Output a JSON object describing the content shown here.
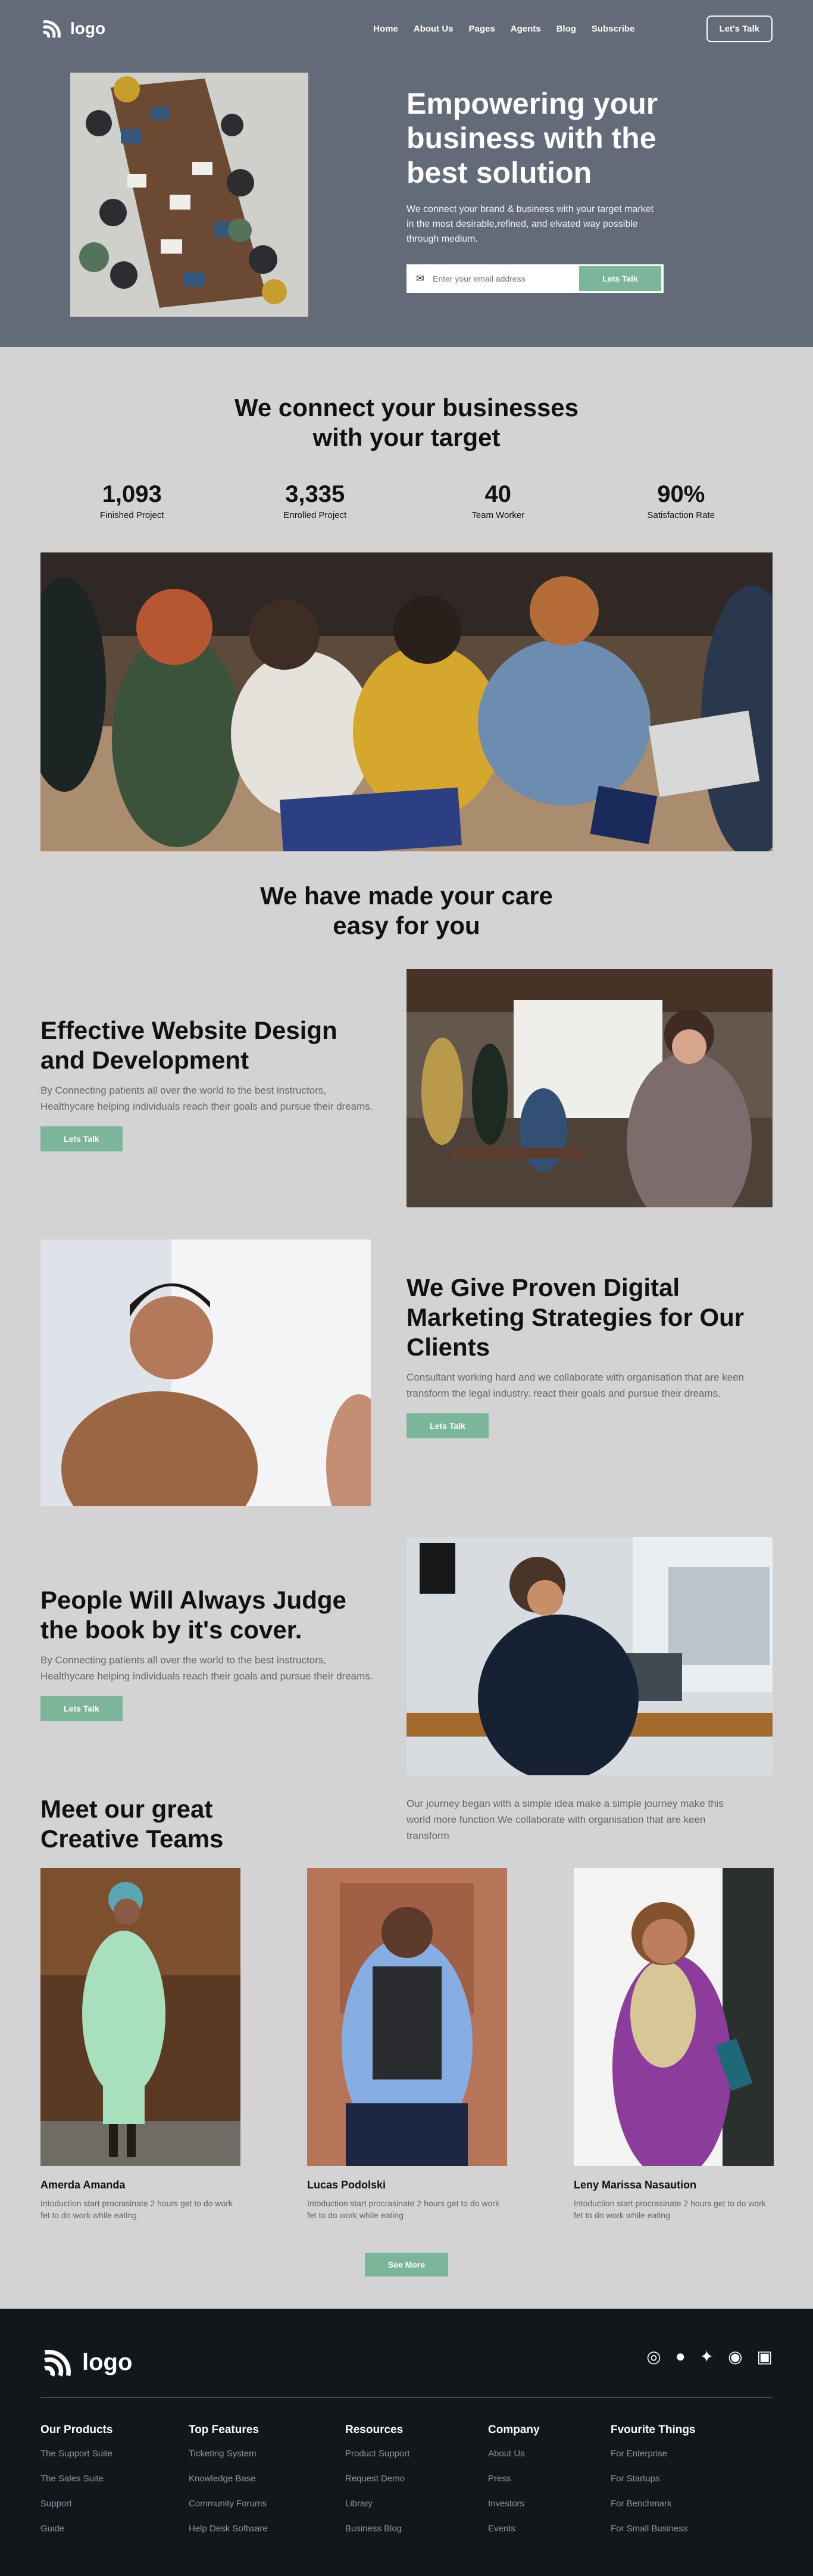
{
  "header": {
    "logo_text": "logo",
    "nav": [
      {
        "label": "Home"
      },
      {
        "label": "About Us"
      },
      {
        "label": "Pages"
      },
      {
        "label": "Agents"
      },
      {
        "label": "Blog"
      },
      {
        "label": "Subscribe"
      }
    ],
    "cta": "Let's Talk"
  },
  "hero": {
    "title": "Empowering your business with the best solution",
    "body": "We connect your brand & business with your target market in the most desirable,refined, and elvated way possible through medium.",
    "email_placeholder": "Enter your email address",
    "button": "Lets Talk"
  },
  "connect": {
    "title": "We connect your businesses with your target",
    "stats": [
      {
        "value": "1,093",
        "label": "Finished Project"
      },
      {
        "value": "3,335",
        "label": "Enrolled Project"
      },
      {
        "value": "40",
        "label": "Team Worker"
      },
      {
        "value": "90%",
        "label": "Satisfaction Rate"
      }
    ]
  },
  "care": {
    "title": "We have made your care easy for you"
  },
  "features": [
    {
      "title": "Effective Website Design and Development",
      "body": "By Connecting patients all over the world to the best instructors, Healthycare helping individuals reach their goals and pursue their dreams.",
      "button": "Lets Talk"
    },
    {
      "title": "We Give Proven Digital Marketing Strategies for Our Clients",
      "body": "Consultant working hard and we collaborate with organisation that are keen transform the legal industry. react their goals and pursue their dreams.",
      "button": "Lets Talk"
    },
    {
      "title": "People Will Always Judge the book by it's cover.",
      "body": "By Connecting patients all over the world to the best instructors, Healthycare helping individuals reach their goals and pursue their dreams.",
      "button": "Lets Talk"
    }
  ],
  "team": {
    "title": "Meet our great Creative Teams",
    "intro": "Our journey began with a simple idea make a simple journey make this world more function.We collaborate with organisation that are keen transform",
    "members": [
      {
        "name": "Amerda Amanda",
        "desc": "Intoduction start procrasinate 2 hours get to do work fet to do work while eating"
      },
      {
        "name": "Lucas Podolski",
        "desc": "Intoduction start procrasinate 2 hours get to do work fet to do work while eating"
      },
      {
        "name": "Leny Marissa Nasaution",
        "desc": "Intoduction start procrasinate 2 hours get to do work fet to do work while eating"
      }
    ],
    "button": "See More"
  },
  "footer": {
    "logo_text": "logo",
    "columns": [
      {
        "title": "Our Products",
        "links": [
          "The Support Suite",
          "The Sales Suite",
          "Support",
          "Guide"
        ]
      },
      {
        "title": "Top Features",
        "links": [
          "Ticketing System",
          "Knowledge Base",
          "Community Forums",
          "Help Desk Software"
        ]
      },
      {
        "title": "Resources",
        "links": [
          "Product Support",
          "Request Demo",
          "Library",
          "Business Blog"
        ]
      },
      {
        "title": "Company",
        "links": [
          "About Us",
          "Press",
          "Investors",
          "Events"
        ]
      },
      {
        "title": "Fvourite Things",
        "links": [
          "For Enterprise",
          "For Startups",
          "For Benchmark",
          "For Small Business"
        ]
      }
    ]
  },
  "colors": {
    "hero": "#646b78",
    "page": "#d3d3d3",
    "green": "#7cb69a",
    "footer": "#12171c"
  },
  "icons": [
    "logo-icon",
    "mail-icon",
    "instagram-icon",
    "facebook-icon",
    "twitter-icon",
    "github-icon",
    "camera-icon"
  ]
}
